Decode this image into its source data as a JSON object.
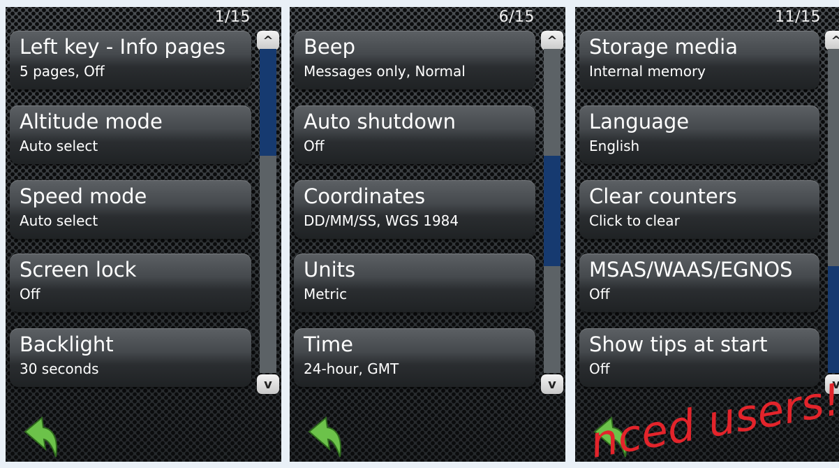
{
  "panels": [
    {
      "counter": "1/15",
      "items": [
        {
          "title": "Left key - Info pages",
          "subtitle": "5 pages, Off"
        },
        {
          "title": "Altitude mode",
          "subtitle": "Auto select"
        },
        {
          "title": "Speed mode",
          "subtitle": "Auto select"
        },
        {
          "title": "Screen lock",
          "subtitle": "Off"
        },
        {
          "title": "Backlight",
          "subtitle": "30 seconds"
        }
      ],
      "scroll_position": {
        "start": 0.0,
        "end": 0.33
      }
    },
    {
      "counter": "6/15",
      "items": [
        {
          "title": "Beep",
          "subtitle": "Messages only, Normal"
        },
        {
          "title": "Auto shutdown",
          "subtitle": "Off"
        },
        {
          "title": "Coordinates",
          "subtitle": "DD/MM/SS, WGS 1984"
        },
        {
          "title": "Units",
          "subtitle": "Metric"
        },
        {
          "title": "Time",
          "subtitle": "24-hour, GMT"
        }
      ],
      "scroll_position": {
        "start": 0.33,
        "end": 0.67
      }
    },
    {
      "counter": "11/15",
      "items": [
        {
          "title": "Storage media",
          "subtitle": "Internal memory"
        },
        {
          "title": "Language",
          "subtitle": "English"
        },
        {
          "title": "Clear counters",
          "subtitle": "Click to clear"
        },
        {
          "title": "MSAS/WAAS/EGNOS",
          "subtitle": "Off"
        },
        {
          "title": "Show tips at start",
          "subtitle": "Off"
        }
      ],
      "scroll_position": {
        "start": 0.67,
        "end": 1.0
      }
    }
  ],
  "icons": {
    "scroll_up": "chevron-up-icon",
    "scroll_down": "chevron-down-icon",
    "back": "back-arrow-icon"
  },
  "scroll_up_glyph": "^",
  "scroll_down_glyph": "v",
  "watermark": "nced users!",
  "colors": {
    "scroll_thumb": "#163a70",
    "back_arrow": "#6cc24a",
    "watermark": "#e3242b"
  }
}
